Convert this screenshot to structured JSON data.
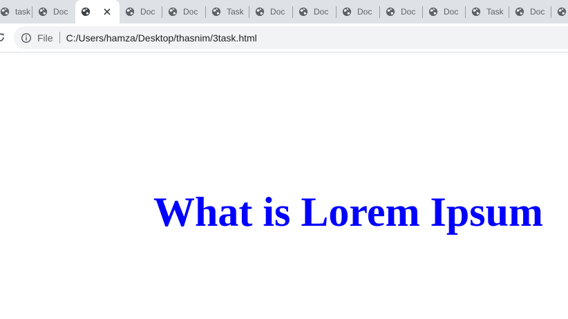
{
  "tabs": [
    {
      "title": "task",
      "active": false
    },
    {
      "title": "Doc",
      "active": false
    },
    {
      "title": "",
      "active": true
    },
    {
      "title": "Doc",
      "active": false
    },
    {
      "title": "Doc",
      "active": false
    },
    {
      "title": "Task",
      "active": false
    },
    {
      "title": "Doc",
      "active": false
    },
    {
      "title": "Doc",
      "active": false
    },
    {
      "title": "Doc",
      "active": false
    },
    {
      "title": "Doc",
      "active": false
    },
    {
      "title": "Doc",
      "active": false
    },
    {
      "title": "Task",
      "active": false
    },
    {
      "title": "Doc",
      "active": false
    },
    {
      "title": "",
      "active": false
    }
  ],
  "omnibox": {
    "scheme_label": "File",
    "url": "C:/Users/hamza/Desktop/thasnim/3task.html"
  },
  "page": {
    "heading": "What is Lorem Ipsum"
  },
  "colors": {
    "heading": "#0000ff",
    "tabstrip": "#dee1e6",
    "omnibox": "#f1f3f4"
  },
  "icons": {
    "tab_favicon": "globe-icon",
    "tab_close": "close-icon",
    "reload": "reload-icon",
    "site_info": "info-icon"
  }
}
